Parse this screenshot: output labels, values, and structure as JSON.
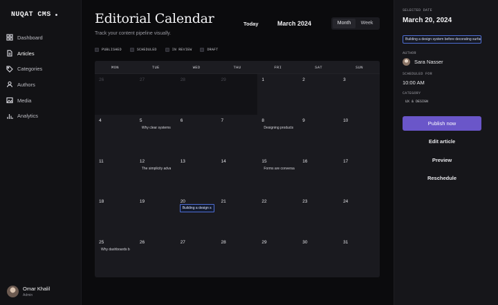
{
  "brand": {
    "name": "NUQAT CMS"
  },
  "sidebar": {
    "items": [
      {
        "label": "Dashboard",
        "icon": "grid-icon"
      },
      {
        "label": "Articles",
        "icon": "file-icon"
      },
      {
        "label": "Categories",
        "icon": "tag-icon"
      },
      {
        "label": "Authors",
        "icon": "user-icon"
      },
      {
        "label": "Media",
        "icon": "image-icon"
      },
      {
        "label": "Analytics",
        "icon": "bar-chart-icon"
      }
    ],
    "active": "Articles",
    "user": {
      "name": "Omar Khalil",
      "role": "Admin"
    }
  },
  "header": {
    "title": "Editorial Calendar",
    "subtitle": "Track your content pipeline visually.",
    "today_label": "Today",
    "month_label": "March 2024",
    "views": [
      "Month",
      "Week"
    ],
    "active_view": "Month"
  },
  "legend": [
    "PUBLISHED",
    "SCHEDULED",
    "IN REVIEW",
    "DRAFT"
  ],
  "calendar": {
    "weekdays": [
      "MON",
      "TUE",
      "WED",
      "THU",
      "FRI",
      "SAT",
      "SUN"
    ],
    "weeks": [
      [
        {
          "day": "26",
          "outside": true
        },
        {
          "day": "27",
          "outside": true
        },
        {
          "day": "28",
          "outside": true
        },
        {
          "day": "29",
          "outside": true
        },
        {
          "day": "1"
        },
        {
          "day": "2"
        },
        {
          "day": "3"
        }
      ],
      [
        {
          "day": "4"
        },
        {
          "day": "5",
          "event": "Why clear systems"
        },
        {
          "day": "6"
        },
        {
          "day": "7"
        },
        {
          "day": "8",
          "event": "Designing products"
        },
        {
          "day": "9"
        },
        {
          "day": "10"
        }
      ],
      [
        {
          "day": "11"
        },
        {
          "day": "12",
          "event": "The simplicity adva"
        },
        {
          "day": "13"
        },
        {
          "day": "14"
        },
        {
          "day": "15",
          "event": "Forms are conversa"
        },
        {
          "day": "16"
        },
        {
          "day": "17"
        }
      ],
      [
        {
          "day": "18"
        },
        {
          "day": "19"
        },
        {
          "day": "20",
          "event": "Building a design s",
          "selected": true
        },
        {
          "day": "21"
        },
        {
          "day": "22"
        },
        {
          "day": "23"
        },
        {
          "day": "24"
        }
      ],
      [
        {
          "day": "25",
          "event": "Why dashboards b"
        },
        {
          "day": "26"
        },
        {
          "day": "27"
        },
        {
          "day": "28"
        },
        {
          "day": "29"
        },
        {
          "day": "30"
        },
        {
          "day": "31"
        }
      ]
    ]
  },
  "panel": {
    "selected_date_label": "SELECTED DATE",
    "selected_date": "March 20, 2024",
    "selected_article": "Building a design system before decorating surfaces",
    "author_label": "AUTHOR",
    "author_name": "Sara Nasser",
    "scheduled_label": "SCHEDULED FOR",
    "scheduled_time": "10:00 AM",
    "category_label": "CATEGORY",
    "category": "UX & DESIGN",
    "publish_label": "Publish now",
    "edit_label": "Edit article",
    "preview_label": "Preview",
    "reschedule_label": "Reschedule",
    "accent_color": "#6a56c9",
    "selection_color": "#4f6fd6"
  }
}
